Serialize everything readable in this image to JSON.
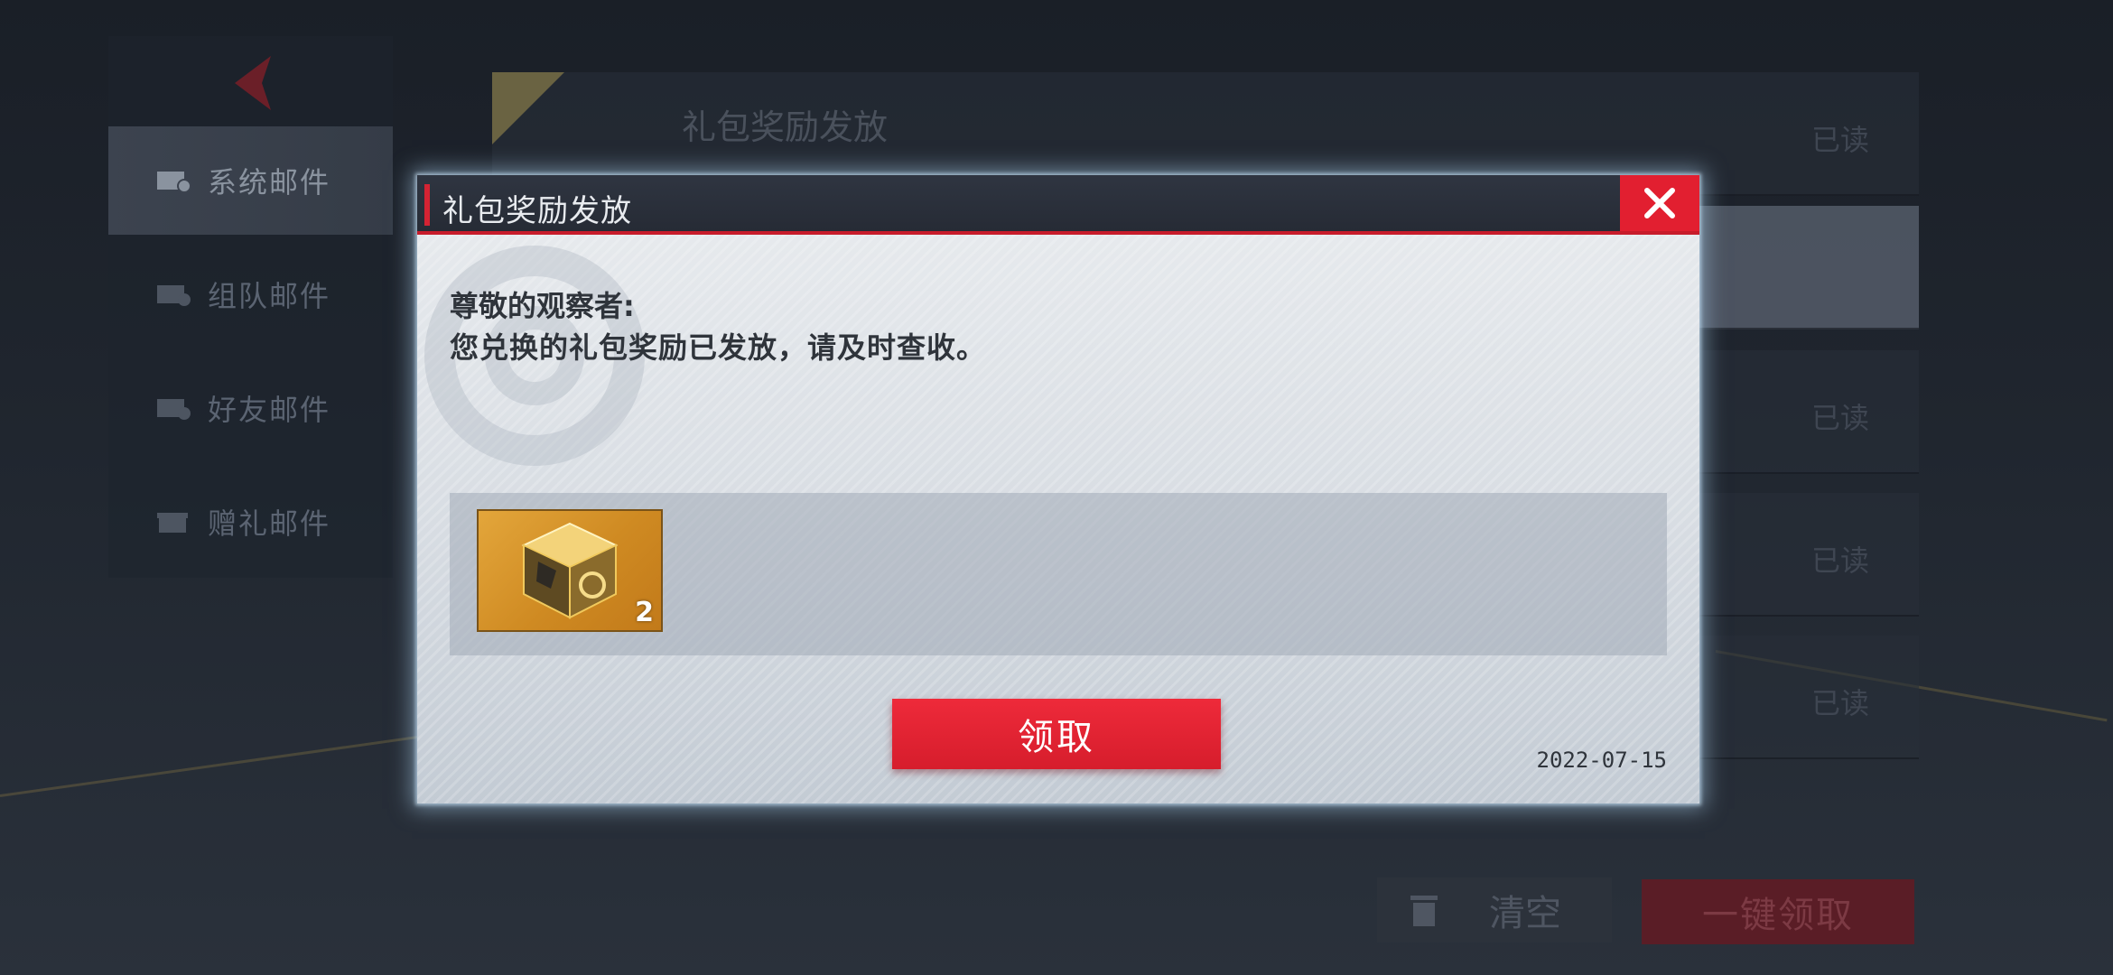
{
  "sidebar": {
    "items": [
      {
        "label": "系统邮件"
      },
      {
        "label": "组队邮件"
      },
      {
        "label": "好友邮件"
      },
      {
        "label": "赠礼邮件"
      }
    ]
  },
  "mail_list": {
    "rows": [
      {
        "title": "礼包奖励发放",
        "status": "已读"
      },
      {
        "title": "",
        "status": ""
      },
      {
        "title": "",
        "status": "已读"
      },
      {
        "title": "",
        "status": "已读"
      },
      {
        "title": "",
        "status": "已读"
      }
    ]
  },
  "footer": {
    "clear_label": "清空",
    "claim_all_label": "一键领取"
  },
  "dialog": {
    "title": "礼包奖励发放",
    "greeting": "尊敬的观察者:",
    "message": "您兑换的礼包奖励已发放，请及时查收。",
    "rewards": [
      {
        "icon": "golden-cube-icon",
        "count": "2"
      }
    ],
    "claim_label": "领取",
    "date": "2022-07-15"
  },
  "colors": {
    "accent_red": "#e21f30",
    "header_dark": "#2a303b"
  }
}
